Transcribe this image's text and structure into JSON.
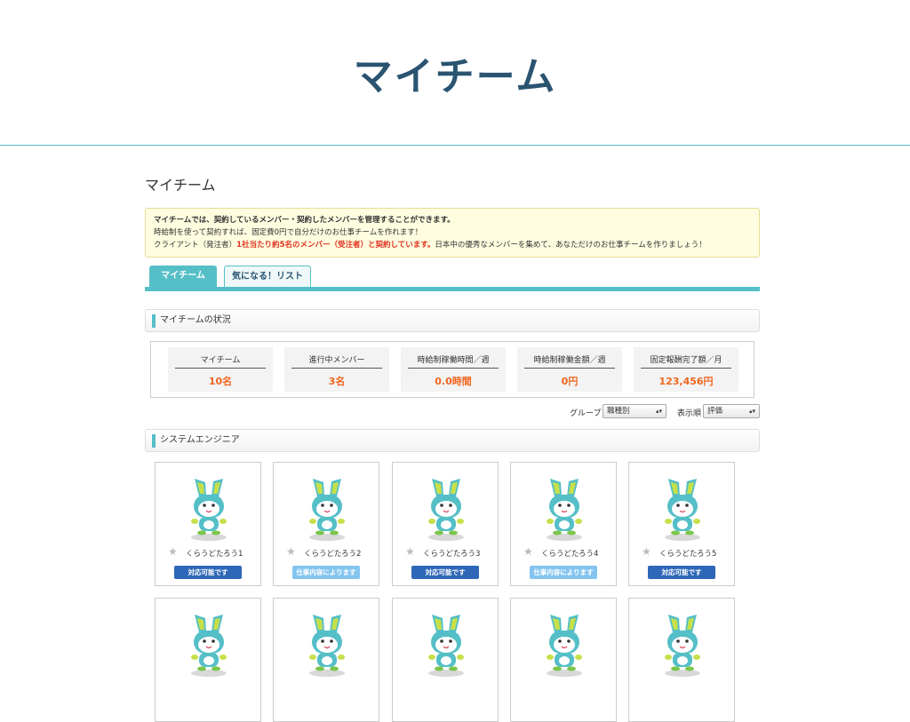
{
  "slide_title": "マイチーム",
  "page_title": "マイチーム",
  "info": {
    "line1": "マイチームでは、契約しているメンバー・契約したメンバーを管理することができます。",
    "line2": "時給制を使って契約すれば、固定費0円で自分だけのお仕事チームを作れます！",
    "line3_pre": "クライアント（発注者）",
    "line3_red": "1社当たり約5名のメンバー（受注者）と契約しています。",
    "line3_post": "日本中の優秀なメンバーを集めて、あなただけのお仕事チームを作りましょう！"
  },
  "tabs": [
    {
      "label": "マイチーム",
      "active": true
    },
    {
      "label": "気になる！リスト",
      "active": false
    }
  ],
  "status_section": "マイチームの状況",
  "stats": [
    {
      "label": "マイチーム",
      "value": "10名"
    },
    {
      "label": "進行中メンバー",
      "value": "3名"
    },
    {
      "label": "時給制稼働時間／週",
      "value": "0.0時間"
    },
    {
      "label": "時給制稼働金額／週",
      "value": "0円"
    },
    {
      "label": "固定報酬完了額／月",
      "value": "123,456円"
    }
  ],
  "filters": {
    "group_label": "グループ",
    "group_value": "職種別",
    "sort_label": "表示順",
    "sort_value": "評価"
  },
  "category": "システムエンジニア",
  "members": [
    {
      "name": "くらうどたろう1",
      "status": "対応可能です",
      "status_type": "blue"
    },
    {
      "name": "くらうどたろう2",
      "status": "仕事内容によります",
      "status_type": "light"
    },
    {
      "name": "くらうどたろう3",
      "status": "対応可能です",
      "status_type": "blue"
    },
    {
      "name": "くらうどたろう4",
      "status": "仕事内容によります",
      "status_type": "light"
    },
    {
      "name": "くらうどたろう5",
      "status": "対応可能です",
      "status_type": "blue"
    }
  ],
  "colors": {
    "accent": "#55bfc7",
    "title": "#2a5470",
    "value": "#f0651f",
    "available": "#2f67b8",
    "depends": "#84c5ef"
  }
}
